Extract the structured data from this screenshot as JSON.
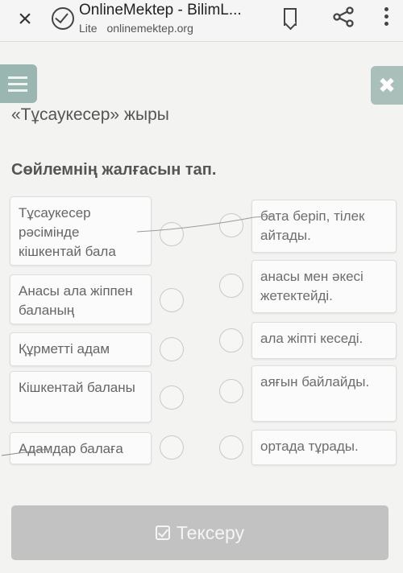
{
  "browser": {
    "site_title": "OnlineMektep - BilimL...",
    "lite_label": "Lite",
    "url": "onlinemektep.org"
  },
  "page": {
    "title": "«Тұсаукесер» жыры",
    "task": "Сөйлемнің жалғасын тап."
  },
  "left_items": [
    "Тұсаукесер рәсімінде кішкентай бала",
    "Анасы ала жіппен баланың",
    "Құрметті адам",
    "Кішкентай баланы",
    "Адамдар балаға"
  ],
  "right_items": [
    "бата беріп, тілек айтады.",
    "анасы мен әкесі жетектейді.",
    "ала жіпті кеседі.",
    "аяғын байлайды.",
    "ортада тұрады."
  ],
  "check_button": "Тексеру",
  "colors": {
    "accent_teal": "#9ab6b0",
    "button_disabled": "#c2c2c2"
  }
}
